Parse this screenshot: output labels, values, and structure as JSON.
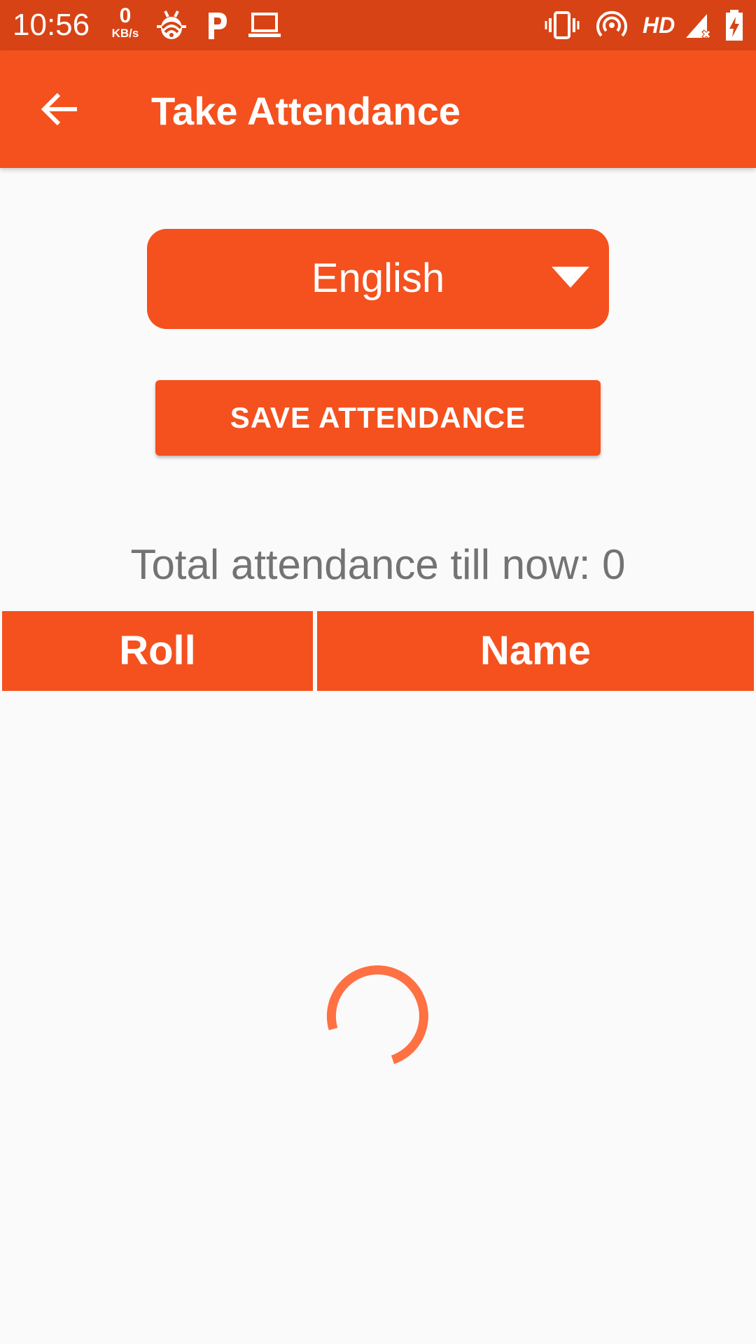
{
  "status_bar": {
    "time": "10:56",
    "net_speed_value": "0",
    "net_speed_unit": "KB/s",
    "icons": [
      "bug-icon",
      "p-icon",
      "laptop-icon",
      "vibrate-icon",
      "hotspot-icon",
      "hd-icon",
      "signal-icon",
      "battery-charging-icon"
    ],
    "hd_label": "HD"
  },
  "app_bar": {
    "title": "Take Attendance",
    "back_icon": "arrow-back-icon"
  },
  "subject_select": {
    "selected": "English",
    "icon": "dropdown-arrow-icon"
  },
  "save_button": {
    "label": "SAVE ATTENDANCE"
  },
  "total_attendance": {
    "text": "Total attendance till now: 0"
  },
  "table": {
    "headers": [
      "Roll",
      "Name"
    ],
    "rows": []
  },
  "loading": {
    "icon": "loading-spinner-icon"
  },
  "colors": {
    "status_bar": "#d84315",
    "primary": "#f4511e",
    "background": "#fafafa",
    "secondary_text": "#737373",
    "spinner": "#ff7043"
  }
}
